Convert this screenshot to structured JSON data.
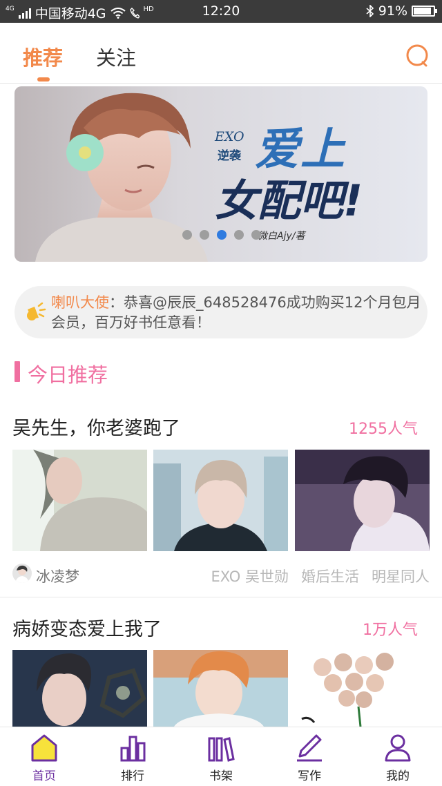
{
  "status_bar": {
    "network_small": "4G",
    "carrier": "中国移动4G",
    "hd": "HD",
    "time": "12:20",
    "battery": "91%",
    "battery_level": 0.91
  },
  "header": {
    "tabs": [
      {
        "label": "推荐",
        "active": true
      },
      {
        "label": "关注",
        "active": false
      }
    ],
    "search_icon": "search-icon"
  },
  "banner": {
    "series_tag": "EXO",
    "series_tag2": "逆袭",
    "title_line1": "爱上",
    "title_line2": "女配吧!",
    "author_credit": "微白Ajy/著",
    "slide_count": 5,
    "active_slide": 3
  },
  "notice": {
    "sender": "喇叭大使",
    "message": "：恭喜@辰辰_648528476成功购买12个月包月会员，百万好书任意看！"
  },
  "section": {
    "title": "今日推荐"
  },
  "books": [
    {
      "title": "吴先生，你老婆跑了",
      "popularity": "1255人气",
      "author": "冰凌梦",
      "tags": [
        "EXO 吴世勋",
        "婚后生活",
        "明星同人"
      ]
    },
    {
      "title": "病娇变态爱上我了",
      "popularity": "1万人气"
    }
  ],
  "bottom_nav": [
    {
      "label": "首页",
      "icon": "home-icon",
      "active": true
    },
    {
      "label": "排行",
      "icon": "ranking-icon",
      "active": false
    },
    {
      "label": "书架",
      "icon": "bookshelf-icon",
      "active": false
    },
    {
      "label": "写作",
      "icon": "pen-icon",
      "active": false
    },
    {
      "label": "我的",
      "icon": "user-icon",
      "active": false
    }
  ],
  "colors": {
    "accent_orange": "#f2894b",
    "accent_pink": "#f06fa0",
    "nav_purple": "#6b2fa0",
    "home_yellow": "#f7e23b",
    "slide_active": "#2f7be0"
  }
}
